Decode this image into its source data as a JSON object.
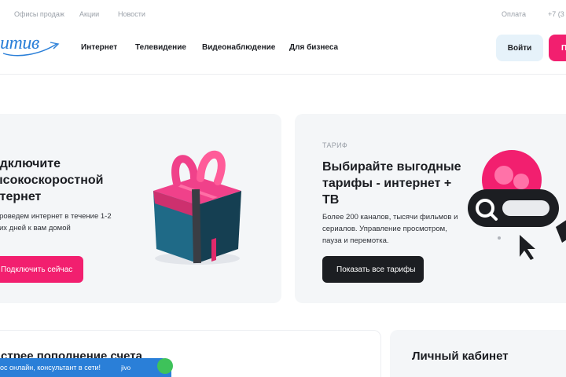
{
  "topbar": {
    "links": [
      "Офисы продаж",
      "Акции",
      "Новости"
    ],
    "pay_label": "Оплата",
    "phone": "+7 (3"
  },
  "header": {
    "logo_text": "итив",
    "nav": [
      "Интернет",
      "Телевидение",
      "Видеонаблюдение",
      "Для бизнеса"
    ],
    "login_label": "Войти",
    "pink_button_label": "П"
  },
  "promo_left": {
    "title_lines": [
      "одключите",
      "ысокоскоростной",
      "нтернет"
    ],
    "text_lines": [
      "проведем интернет в течение 1-2",
      "чих дней к вам домой"
    ],
    "button_label": "Подключить сейчас",
    "image": "gift-box-icon"
  },
  "promo_right": {
    "tag": "ТАРИФ",
    "title_lines": [
      "Выбирайте выгодные",
      "тарифы - интернет +",
      "ТВ"
    ],
    "text_lines": [
      "Более 200 каналов, тысячи фильмов и",
      "сериалов. Управление просмотром,",
      "пауза и перемотка."
    ],
    "button_label": "Показать все тарифы",
    "image": "search-and-play-icon"
  },
  "bottom": {
    "left_title": "стрее пополнение счета",
    "right_title": "Личный кабинет"
  },
  "chat": {
    "label": "ос онлайн, консультант в сети!",
    "brand": "jivo"
  },
  "colors": {
    "accent_pink": "#f21f6f",
    "accent_blue": "#2a7fd8",
    "login_bg": "#e6f2fa",
    "card_bg": "#f4f6f8",
    "dark_button": "#1c1e22"
  }
}
